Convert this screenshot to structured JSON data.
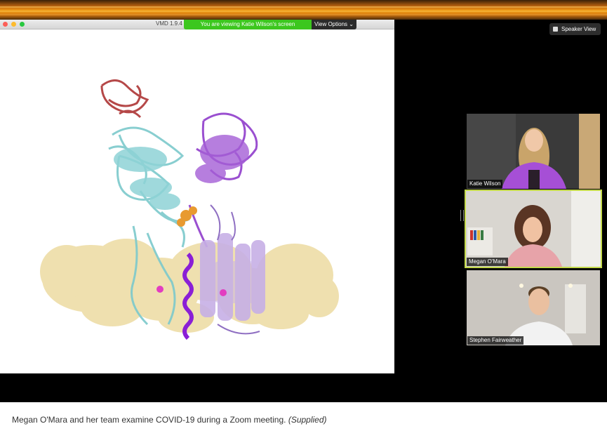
{
  "vmd_window": {
    "title": "VMD 1.9.4"
  },
  "share_banner": {
    "text": "You are viewing Katie Wilson's screen"
  },
  "view_options": {
    "label": "View Options",
    "icon": "chevron-down-icon"
  },
  "speaker_view": {
    "label": "Speaker View",
    "icon": "grid-icon"
  },
  "participants": [
    {
      "name": "Katie Wilson",
      "active": false
    },
    {
      "name": "Megan O'Mara",
      "active": true
    },
    {
      "name": "Stephen Fairweather",
      "active": false
    }
  ],
  "caption": {
    "text": "Megan O'Mara and her team examine COVID-19 during a Zoom meeting.",
    "credit": "(Supplied)"
  },
  "colors": {
    "banner_green": "#3cc71e",
    "active_speaker": "#c3d94a",
    "membrane": "#efdfab",
    "cyan_protein": "#7cc9cc",
    "purple_protein": "#9a4fd0",
    "red_protein": "#b54848"
  }
}
